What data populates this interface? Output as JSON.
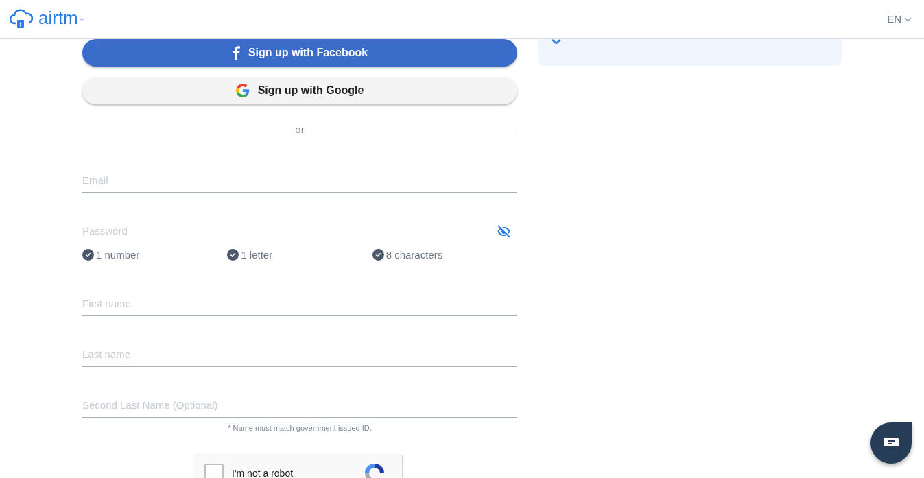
{
  "header": {
    "logo_text": "airtm",
    "trademark": "™",
    "language": "EN"
  },
  "social_buttons": [
    {
      "kind": "facebook",
      "label": "Sign up with Facebook"
    },
    {
      "kind": "google",
      "label": "Sign up with Google"
    }
  ],
  "divider_text": "or",
  "fields": [
    {
      "kind": "text",
      "placeholder": "Email"
    },
    {
      "kind": "password",
      "placeholder": "Password"
    },
    {
      "kind": "text",
      "placeholder": "First name"
    },
    {
      "kind": "text",
      "placeholder": "Last name"
    },
    {
      "kind": "text",
      "placeholder": "Second Last Name (Optional)"
    }
  ],
  "password_rules": [
    {
      "label": "1 number",
      "checked": true
    },
    {
      "label": "1 letter",
      "checked": true
    },
    {
      "label": "8 characters",
      "checked": true
    }
  ],
  "name_note": "* Name must match government issued ID.",
  "captcha": {
    "label": "I'm not a robot",
    "checked": false
  }
}
